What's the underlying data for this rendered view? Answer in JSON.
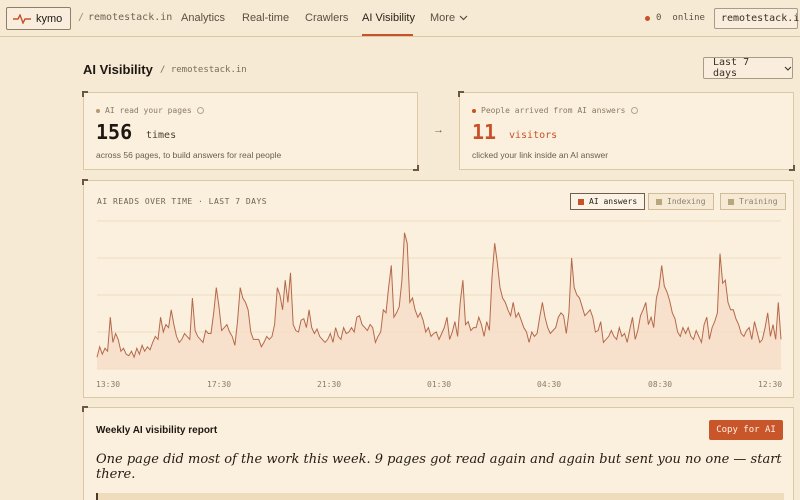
{
  "app": {
    "logo_text": "kymo",
    "site": "remotestack.in"
  },
  "nav": {
    "items": [
      "Analytics",
      "Real-time",
      "Crawlers",
      "AI Visibility",
      "More"
    ],
    "active": "AI Visibility",
    "online_count": "0",
    "online_label": "online",
    "site_select": "remotestack.in"
  },
  "header": {
    "title": "AI Visibility",
    "crumb": "/ remotestack.in",
    "range": "Last 7 days"
  },
  "stats": {
    "reads": {
      "label": "AI read your pages",
      "value": "156",
      "unit": "times",
      "sub": "across 56 pages, to build answers for real people"
    },
    "arrivals": {
      "label": "People arrived from AI answers",
      "value": "11",
      "unit": "visitors",
      "sub": "clicked your link inside an AI answer"
    },
    "arrow": "→"
  },
  "chart": {
    "title": "AI READS OVER TIME · LAST 7 DAYS",
    "legend": [
      {
        "label": "AI answers",
        "color": "#c7522a",
        "active": true
      },
      {
        "label": "Indexing",
        "color": "#b9a57e",
        "active": false
      },
      {
        "label": "Training",
        "color": "#b9a57e",
        "active": false
      }
    ]
  },
  "chart_data": {
    "type": "area",
    "x_ticks": [
      "13:30",
      "17:30",
      "21:30",
      "01:30",
      "04:30",
      "08:30",
      "12:30"
    ],
    "ylim": [
      0,
      100
    ],
    "grid": true,
    "series": [
      {
        "color": "#b5694a",
        "values": [
          8,
          15,
          10,
          14,
          12,
          35,
          18,
          24,
          20,
          12,
          14,
          10,
          9,
          12,
          8,
          14,
          10,
          16,
          12,
          15,
          13,
          18,
          22,
          20,
          35,
          25,
          30,
          28,
          40,
          30,
          22,
          18,
          20,
          24,
          22,
          20,
          48,
          26,
          22,
          20,
          18,
          26,
          24,
          24,
          38,
          55,
          42,
          26,
          28,
          30,
          25,
          22,
          16,
          32,
          55,
          48,
          45,
          40,
          25,
          20,
          20,
          20,
          15,
          18,
          22,
          20,
          22,
          30,
          55,
          50,
          40,
          60,
          45,
          65,
          30,
          26,
          25,
          33,
          34,
          28,
          40,
          28,
          24,
          27,
          22,
          20,
          18,
          20,
          24,
          18,
          28,
          22,
          20,
          28,
          24,
          25,
          28,
          25,
          35,
          36,
          30,
          28,
          26,
          30,
          28,
          18,
          22,
          25,
          40,
          38,
          55,
          70,
          35,
          38,
          42,
          60,
          92,
          85,
          45,
          48,
          40,
          35,
          38,
          33,
          25,
          28,
          22,
          24,
          25,
          20,
          24,
          28,
          35,
          20,
          25,
          32,
          22,
          45,
          60,
          30,
          32,
          26,
          28,
          28,
          35,
          30,
          22,
          32,
          26,
          62,
          85,
          72,
          55,
          48,
          45,
          40,
          36,
          45,
          35,
          38,
          33,
          28,
          25,
          18,
          25,
          22,
          24,
          35,
          45,
          35,
          28,
          24,
          26,
          28,
          35,
          38,
          36,
          24,
          38,
          75,
          55,
          50,
          48,
          42,
          36,
          38,
          40,
          35,
          25,
          26,
          32,
          18,
          20,
          22,
          26,
          22,
          20,
          28,
          22,
          24,
          18,
          27,
          35,
          20,
          26,
          36,
          40,
          45,
          30,
          35,
          28,
          48,
          55,
          70,
          56,
          52,
          46,
          38,
          34,
          25,
          22,
          28,
          24,
          28,
          22,
          20,
          26,
          22,
          18,
          30,
          35,
          20,
          28,
          32,
          38,
          78,
          58,
          60,
          45,
          40,
          40,
          34,
          30,
          24,
          22,
          26,
          28,
          20,
          32,
          25,
          18,
          20,
          28,
          38,
          22,
          30,
          20,
          45,
          20
        ]
      }
    ]
  },
  "report": {
    "title": "Weekly AI visibility report",
    "copy_label": "Copy for AI",
    "body": "One page did most of the work this week. 9 pages got read again and again but sent you no one — start there."
  }
}
